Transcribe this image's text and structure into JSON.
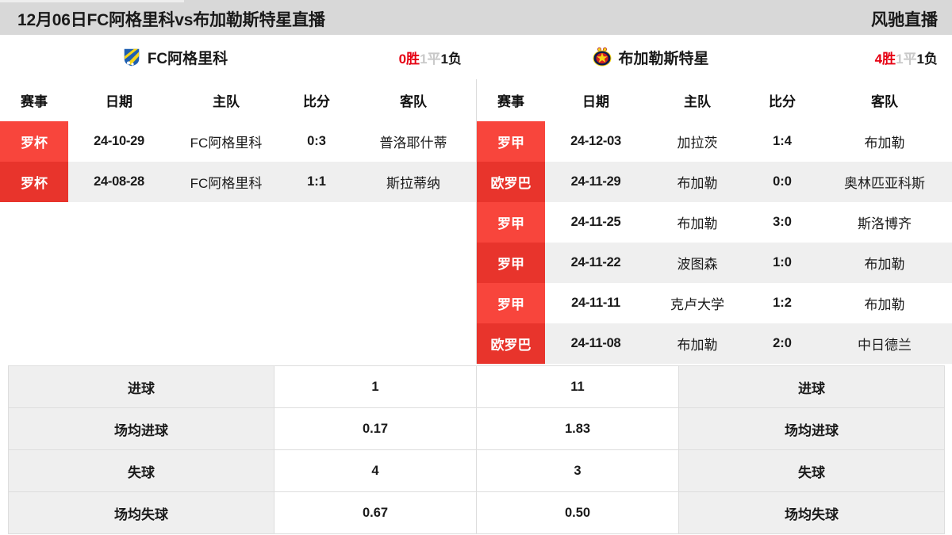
{
  "header": {
    "title": "12月06日FC阿格里科vs布加勒斯特星直播",
    "brand": "风驰直播"
  },
  "teams": {
    "home": {
      "name": "FC阿格里科",
      "logo_icon": "shield-blue-yellow-logo",
      "record": {
        "win": "0胜",
        "draw": "1平",
        "lose": "1负"
      }
    },
    "away": {
      "name": "布加勒斯特星",
      "logo_icon": "star-crest-logo",
      "record": {
        "win": "4胜",
        "draw": "1平",
        "lose": "1负"
      }
    }
  },
  "match_table_columns": [
    "赛事",
    "日期",
    "主队",
    "比分",
    "客队"
  ],
  "home_matches": [
    {
      "comp": "罗杯",
      "date": "24-10-29",
      "home": "FC阿格里科",
      "score": "0:3",
      "away": "普洛耶什蒂"
    },
    {
      "comp": "罗杯",
      "date": "24-08-28",
      "home": "FC阿格里科",
      "score": "1:1",
      "away": "斯拉蒂纳"
    }
  ],
  "away_matches": [
    {
      "comp": "罗甲",
      "date": "24-12-03",
      "home": "加拉茨",
      "score": "1:4",
      "away": "布加勒"
    },
    {
      "comp": "欧罗巴",
      "date": "24-11-29",
      "home": "布加勒",
      "score": "0:0",
      "away": "奥林匹亚科斯"
    },
    {
      "comp": "罗甲",
      "date": "24-11-25",
      "home": "布加勒",
      "score": "3:0",
      "away": "斯洛博齐"
    },
    {
      "comp": "罗甲",
      "date": "24-11-22",
      "home": "波图森",
      "score": "1:0",
      "away": "布加勒"
    },
    {
      "comp": "罗甲",
      "date": "24-11-11",
      "home": "克卢大学",
      "score": "1:2",
      "away": "布加勒"
    },
    {
      "comp": "欧罗巴",
      "date": "24-11-08",
      "home": "布加勒",
      "score": "2:0",
      "away": "中日德兰"
    }
  ],
  "stats": [
    {
      "label_left": "进球",
      "value_left": "1",
      "value_right": "11",
      "label_right": "进球"
    },
    {
      "label_left": "场均进球",
      "value_left": "0.17",
      "value_right": "1.83",
      "label_right": "场均进球"
    },
    {
      "label_left": "失球",
      "value_left": "4",
      "value_right": "3",
      "label_right": "失球"
    },
    {
      "label_left": "场均失球",
      "value_left": "0.67",
      "value_right": "0.50",
      "label_right": "场均失球"
    }
  ],
  "colors": {
    "badge_red": "#f8453c",
    "badge_red_alt": "#e8342c",
    "win_red": "#e60012",
    "topbar_gray": "#d8d8d8",
    "row_alt_gray": "#efefef"
  }
}
